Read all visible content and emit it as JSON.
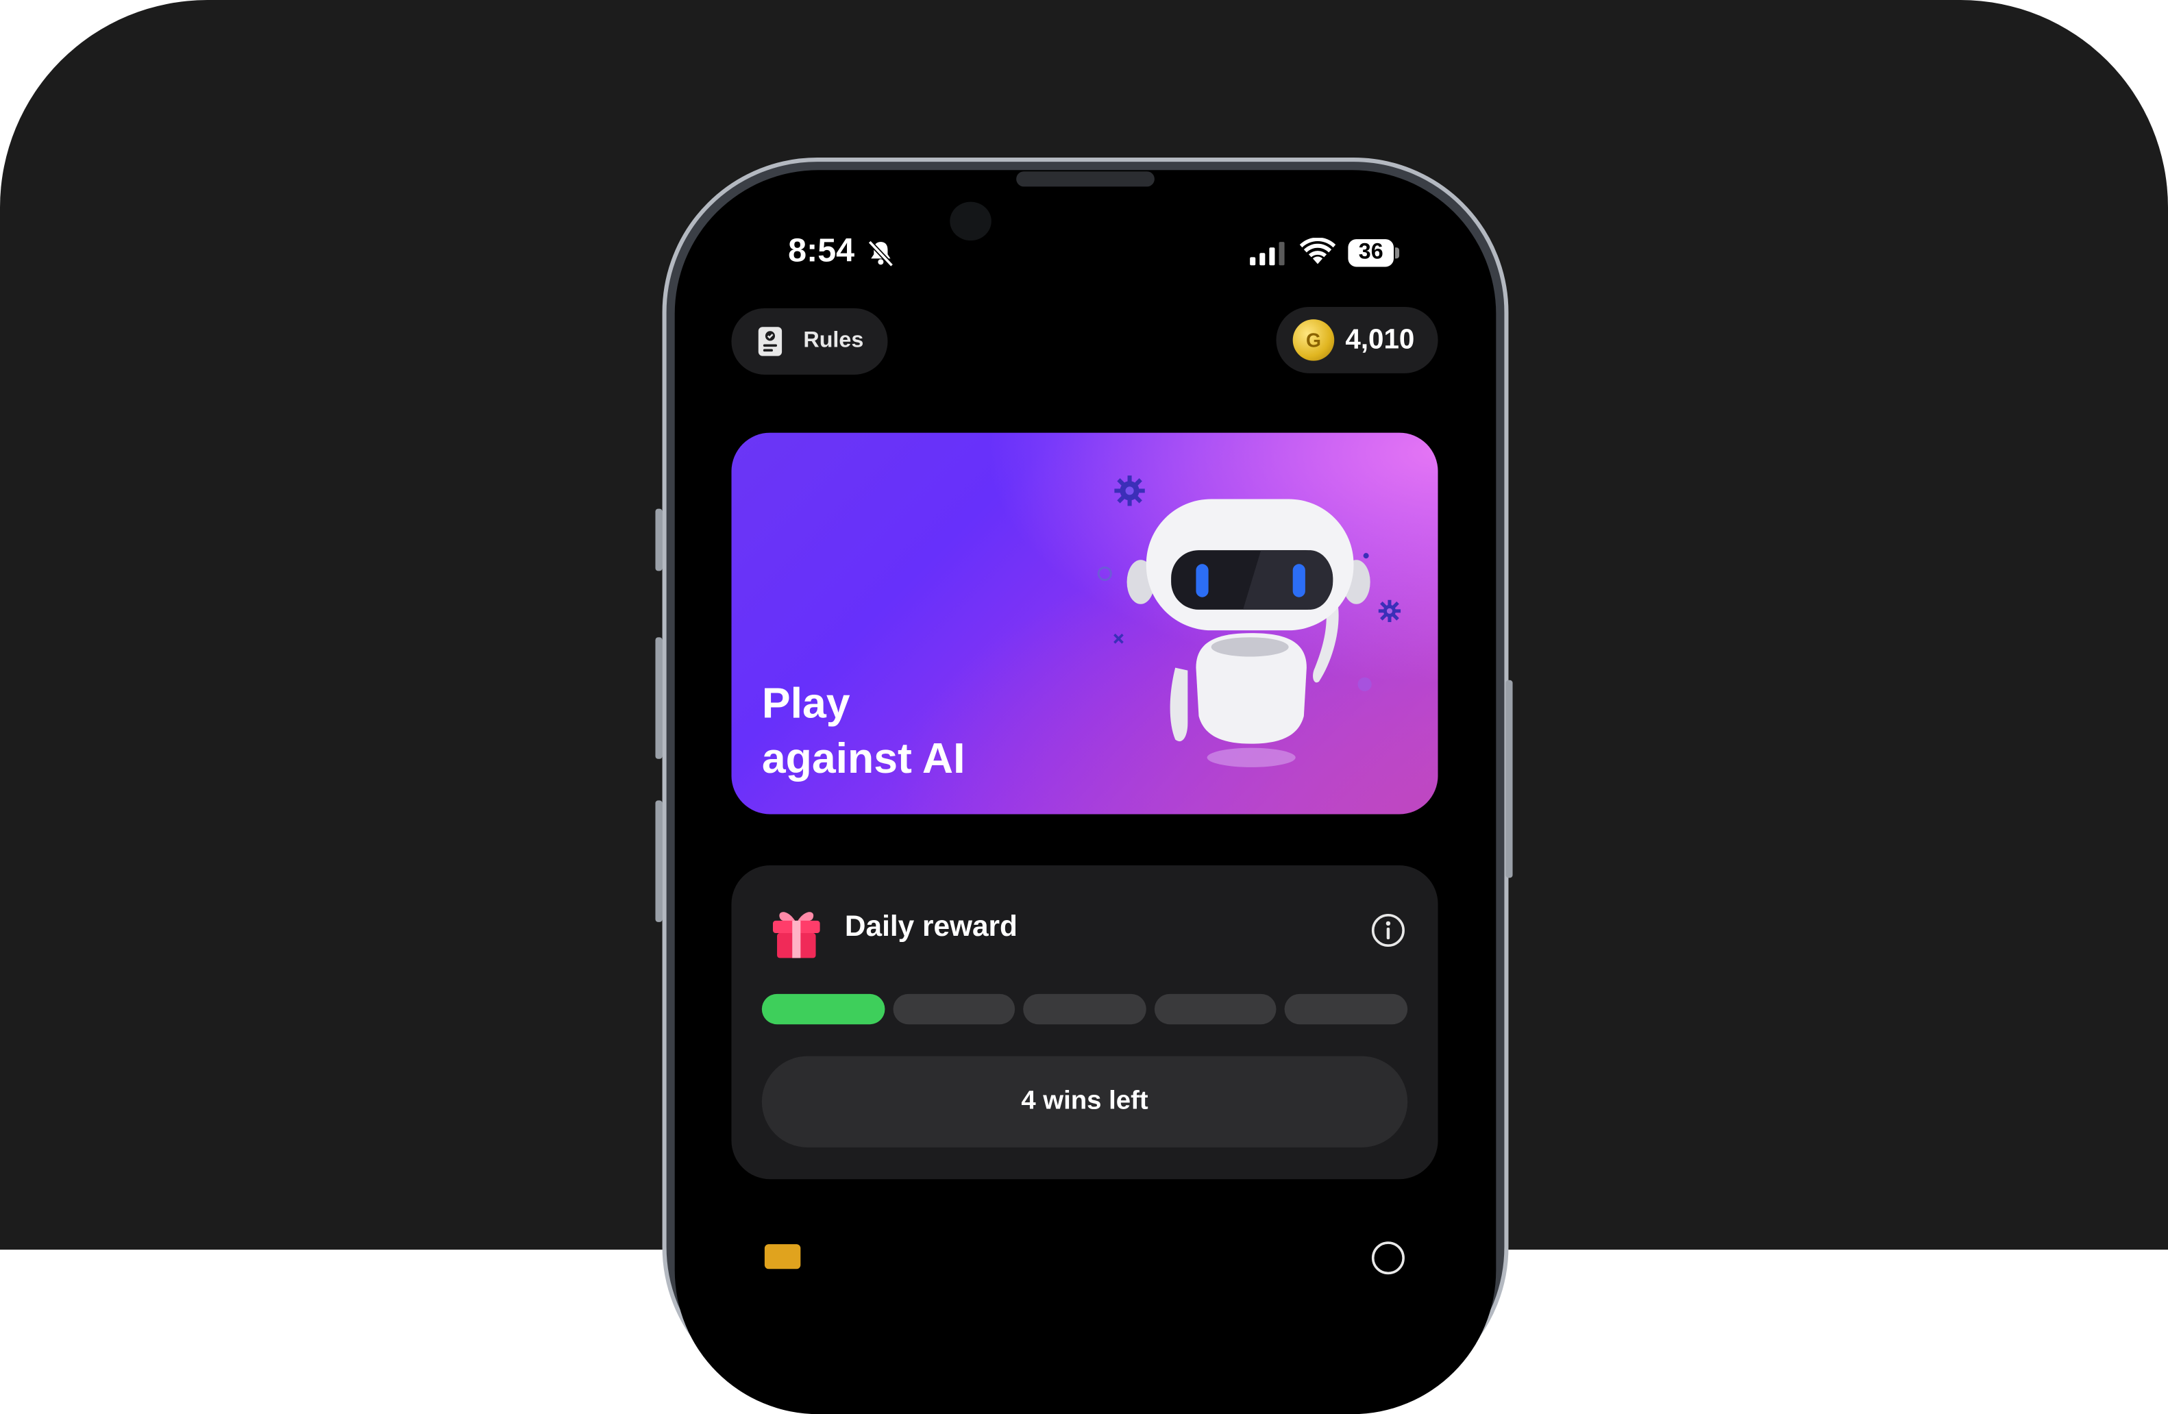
{
  "status_bar": {
    "time": "8:54",
    "battery": "36",
    "icons": [
      "bell-slash-icon",
      "cellular-signal-icon",
      "wifi-icon",
      "battery-icon"
    ]
  },
  "header": {
    "rules_label": "Rules",
    "coins": "4,010",
    "coin_letter": "G"
  },
  "ai_card": {
    "title_line1": "Play",
    "title_line2": "against AI"
  },
  "daily_reward": {
    "title": "Daily reward",
    "progress_total": 5,
    "progress_completed": 1,
    "wins_left_label": "4 wins left"
  },
  "colors": {
    "background": "#1c1c1c",
    "card": "#1c1c1e",
    "progress_done": "#3ecf5b",
    "progress_todo": "#3a3a3c",
    "ai_gradient_start": "#6730fb",
    "ai_gradient_end": "#c24fd8"
  }
}
